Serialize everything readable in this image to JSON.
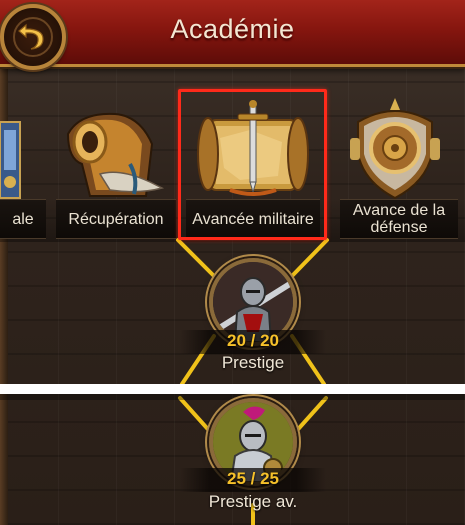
{
  "header": {
    "title": "Académie"
  },
  "categories": [
    {
      "label": "ale",
      "selected": false
    },
    {
      "label": "Récupération",
      "selected": false
    },
    {
      "label": "Avancée militaire",
      "selected": true
    },
    {
      "label": "Avance de la défense",
      "selected": false
    }
  ],
  "nodes": [
    {
      "progress": "20 / 20",
      "label": "Prestige"
    },
    {
      "progress": "25 / 25",
      "label": "Prestige av."
    }
  ],
  "colors": {
    "header_red": "#86160f",
    "progress_gold": "#f6c12a",
    "selection_red": "#ff2a1a",
    "connector_gold": "#f0c21a"
  }
}
